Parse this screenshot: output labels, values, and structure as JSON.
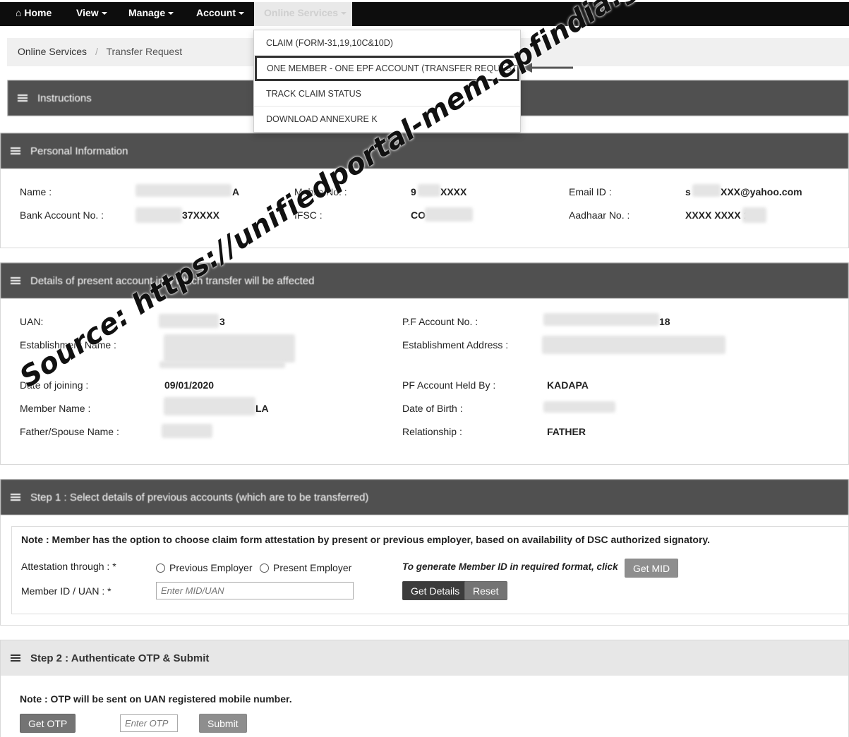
{
  "nav": {
    "home": "Home",
    "view": "View",
    "manage": "Manage",
    "account": "Account",
    "online_services": "Online Services"
  },
  "dropdown": {
    "items": [
      "CLAIM (FORM-31,19,10C&10D)",
      "ONE MEMBER - ONE EPF ACCOUNT (TRANSFER REQUEST)",
      "TRACK CLAIM STATUS",
      "DOWNLOAD ANNEXURE K"
    ]
  },
  "breadcrumb": {
    "root": "Online Services",
    "sep": "/",
    "current": "Transfer Request"
  },
  "instructions": {
    "title": "Instructions"
  },
  "personal": {
    "title": "Personal Information",
    "name_label": "Name :",
    "name_value": "A",
    "mobile_label": "Mobile No. :",
    "mobile_prefix": "9",
    "mobile_suffix": "XXXX",
    "email_label": "Email ID :",
    "email_prefix": "s",
    "email_suffix": "XXX@yahoo.com",
    "bank_label": "Bank Account No. :",
    "bank_value": "37XXXX",
    "ifsc_label": "IFSC :",
    "ifsc_value": "CO",
    "aadhaar_label": "Aadhaar No. :",
    "aadhaar_value": "XXXX XXXX 1"
  },
  "present": {
    "title": "Details of present account into which transfer will be affected",
    "uan_label": "UAN:",
    "uan_value": "3",
    "pf_label": "P.F Account No. :",
    "pf_value": "18",
    "est_name_label": "Establishment Name :",
    "est_addr_label": "Establishment Address :",
    "doj_label": "Date of joining :",
    "doj_value": "09/01/2020",
    "held_label": "PF Account Held By :",
    "held_value": "KADAPA",
    "member_label": "Member Name :",
    "member_value": "LA",
    "dob_label": "Date of Birth :",
    "father_label": "Father/Spouse Name :",
    "rel_label": "Relationship :",
    "rel_value": "FATHER"
  },
  "step1": {
    "title": "Step 1 : Select details of previous accounts (which are to be transferred)",
    "note": "Note : Member has the option to choose claim form attestation by present or previous employer, based on availability of DSC authorized signatory.",
    "attest_label": "Attestation through : *",
    "prev_employer": "Previous Employer",
    "present_employer": "Present Employer",
    "mid_hint": "To generate Member ID in required format, click",
    "get_mid": "Get MID",
    "member_id_label": "Member ID / UAN : *",
    "member_id_placeholder": "Enter MID/UAN",
    "get_details": "Get Details",
    "reset": "Reset"
  },
  "step2": {
    "title": "Step 2 : Authenticate OTP & Submit",
    "note": "Note : OTP will be sent on UAN registered mobile number.",
    "get_otp": "Get OTP",
    "otp_placeholder": "Enter OTP",
    "submit": "Submit"
  },
  "watermark": "Source: https://unifiedportal-mem.epfindia.gov.in/memberinterface/"
}
